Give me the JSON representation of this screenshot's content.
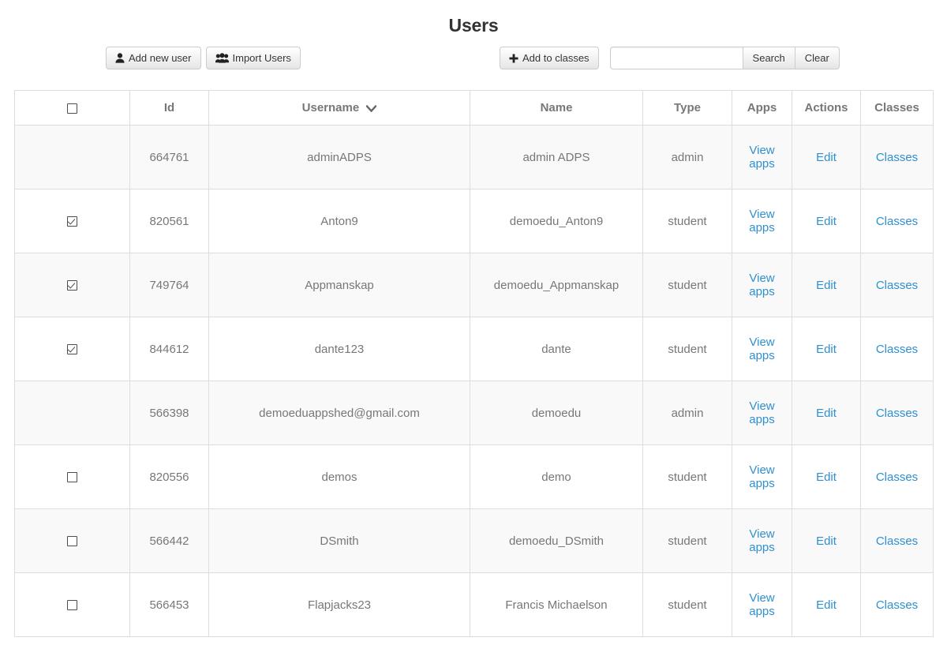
{
  "page": {
    "title": "Users"
  },
  "toolbar": {
    "add_new_user_label": "Add new user",
    "add_new_user_icon": "user-icon",
    "import_users_label": "Import Users",
    "import_users_icon": "users-group-icon",
    "add_to_classes_label": "Add to classes",
    "add_to_classes_icon": "plus-icon",
    "search_value": "",
    "search_placeholder": "",
    "search_button_label": "Search",
    "clear_button_label": "Clear"
  },
  "table": {
    "select_all_checked": false,
    "columns": [
      {
        "key": "check",
        "label": ""
      },
      {
        "key": "id",
        "label": "Id"
      },
      {
        "key": "username",
        "label": "Username",
        "sorted": true,
        "sort_icon": "chevron-down-icon"
      },
      {
        "key": "name",
        "label": "Name"
      },
      {
        "key": "type",
        "label": "Type"
      },
      {
        "key": "apps",
        "label": "Apps"
      },
      {
        "key": "actions",
        "label": "Actions"
      },
      {
        "key": "classes",
        "label": "Classes"
      }
    ],
    "link_labels": {
      "apps": "View apps",
      "edit": "Edit",
      "classes": "Classes"
    },
    "rows": [
      {
        "selectable": false,
        "checked": false,
        "id": "664761",
        "username": "adminADPS",
        "name": "admin ADPS",
        "type": "admin",
        "apps": "View apps",
        "actions": "Edit",
        "classes": "Classes"
      },
      {
        "selectable": true,
        "checked": true,
        "id": "820561",
        "username": "Anton9",
        "name": "demoedu_Anton9",
        "type": "student",
        "apps": "View apps",
        "actions": "Edit",
        "classes": "Classes"
      },
      {
        "selectable": true,
        "checked": true,
        "id": "749764",
        "username": "Appmanskap",
        "name": "demoedu_Appmanskap",
        "type": "student",
        "apps": "View apps",
        "actions": "Edit",
        "classes": "Classes"
      },
      {
        "selectable": true,
        "checked": true,
        "id": "844612",
        "username": "dante123",
        "name": "dante",
        "type": "student",
        "apps": "View apps",
        "actions": "Edit",
        "classes": "Classes"
      },
      {
        "selectable": false,
        "checked": false,
        "id": "566398",
        "username": "demoeduappshed@gmail.com",
        "name": "demoedu",
        "type": "admin",
        "apps": "View apps",
        "actions": "Edit",
        "classes": "Classes"
      },
      {
        "selectable": true,
        "checked": false,
        "id": "820556",
        "username": "demos",
        "name": "demo",
        "type": "student",
        "apps": "View apps",
        "actions": "Edit",
        "classes": "Classes"
      },
      {
        "selectable": true,
        "checked": false,
        "id": "566442",
        "username": "DSmith",
        "name": "demoedu_DSmith",
        "type": "student",
        "apps": "View apps",
        "actions": "Edit",
        "classes": "Classes"
      },
      {
        "selectable": true,
        "checked": false,
        "id": "566453",
        "username": "Flapjacks23",
        "name": "Francis Michaelson",
        "type": "student",
        "apps": "View apps",
        "actions": "Edit",
        "classes": "Classes"
      }
    ]
  },
  "colors": {
    "link": "#2f8fd0",
    "text": "#777777",
    "title": "#333333",
    "border": "#dddddd",
    "stripe": "#f9f9f9"
  }
}
